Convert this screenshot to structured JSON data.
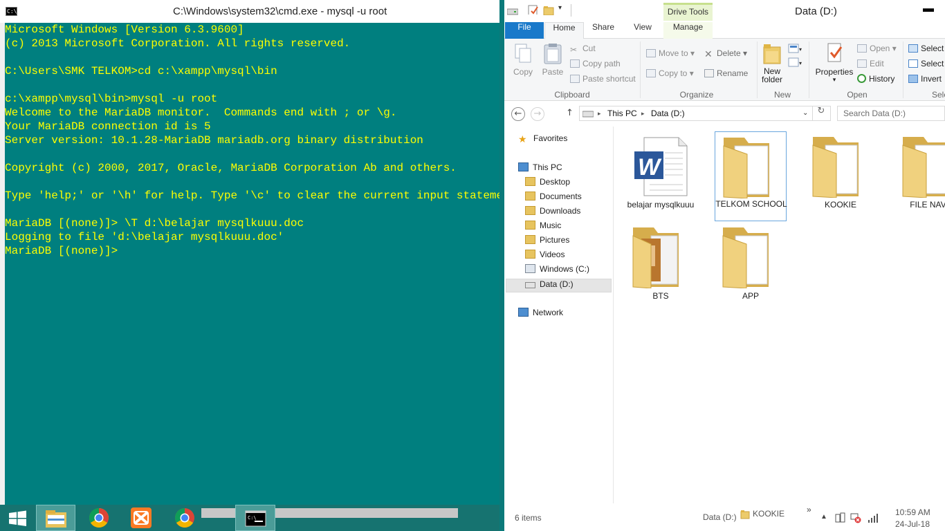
{
  "cmd": {
    "title": "C:\\Windows\\system32\\cmd.exe - mysql  -u root",
    "icon_text": "C:\\.",
    "lines": [
      "Microsoft Windows [Version 6.3.9600]",
      "(c) 2013 Microsoft Corporation. All rights reserved.",
      "",
      "C:\\Users\\SMK TELKOM>cd c:\\xampp\\mysql\\bin",
      "",
      "c:\\xampp\\mysql\\bin>mysql -u root",
      "Welcome to the MariaDB monitor.  Commands end with ; or \\g.",
      "Your MariaDB connection id is 5",
      "Server version: 10.1.28-MariaDB mariadb.org binary distribution",
      "",
      "Copyright (c) 2000, 2017, Oracle, MariaDB Corporation Ab and others.",
      "",
      "Type 'help;' or '\\h' for help. Type '\\c' to clear the current input statement.",
      "",
      "MariaDB [(none)]> \\T d:\\belajar mysqlkuuu.doc",
      "Logging to file 'd:\\belajar mysqlkuuu.doc'",
      "MariaDB [(none)]>"
    ],
    "colors": {
      "console_bg": "#007f7f",
      "text": "#ffff00"
    }
  },
  "explorer": {
    "title": "Data (D:)",
    "contextual_tab_group": "Drive Tools",
    "tabs": [
      "File",
      "Home",
      "Share",
      "View",
      "Manage"
    ],
    "ribbon": {
      "clipboard": {
        "label": "Clipboard",
        "copy": "Copy",
        "paste": "Paste",
        "cut": "Cut",
        "copy_path": "Copy path",
        "paste_shortcut": "Paste shortcut"
      },
      "organize": {
        "label": "Organize",
        "move_to": "Move to",
        "copy_to": "Copy to",
        "delete": "Delete",
        "rename": "Rename"
      },
      "new": {
        "label": "New",
        "new_folder": "New folder"
      },
      "open": {
        "label": "Open",
        "properties": "Properties",
        "open": "Open",
        "edit": "Edit",
        "history": "History"
      },
      "select": {
        "label": "Sele",
        "select_all": "Select",
        "select_none": "Select",
        "invert": "Invert"
      }
    },
    "address": {
      "crumbs": [
        "This PC",
        "Data (D:)"
      ],
      "search_placeholder": "Search Data (D:)"
    },
    "nav": {
      "favorites": "Favorites",
      "this_pc": "This PC",
      "items": [
        "Desktop",
        "Documents",
        "Downloads",
        "Music",
        "Pictures",
        "Videos",
        "Windows (C:)",
        "Data (D:)"
      ],
      "network": "Network"
    },
    "files": [
      {
        "name": "belajar mysqlkuuu",
        "type": "word-doc"
      },
      {
        "name": "TELKOM SCHOOL",
        "type": "folder"
      },
      {
        "name": "KOOKIE",
        "type": "folder"
      },
      {
        "name": "FILE NAVA",
        "type": "folder"
      },
      {
        "name": "BTS",
        "type": "folder"
      },
      {
        "name": "APP",
        "type": "folder"
      }
    ],
    "status": "6 items"
  },
  "tray": {
    "toolbar_label": "Data (D:)",
    "folder_label": "KOOKIE",
    "chevron": "»",
    "time": "10:59 AM",
    "date": "24-Jul-18"
  },
  "taskbar": {
    "apps": [
      "start-button",
      "file-explorer",
      "chrome",
      "xampp",
      "chrome",
      "cmd"
    ]
  }
}
